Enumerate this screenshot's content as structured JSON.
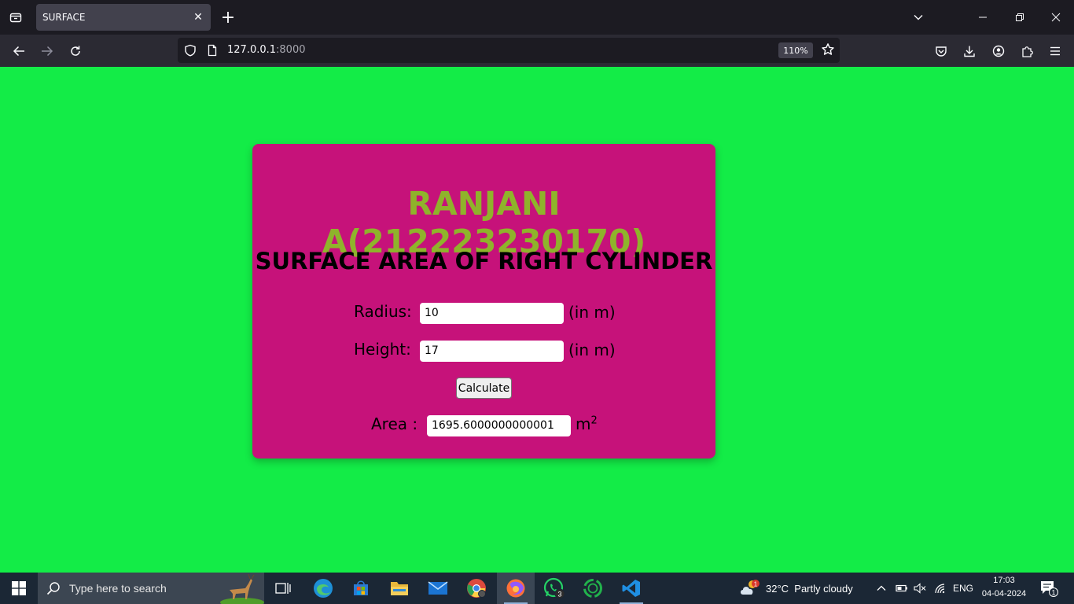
{
  "browser": {
    "tab_title": "SURFACE",
    "url_host": "127.0.0.1",
    "url_port": ":8000",
    "zoom": "110%"
  },
  "card": {
    "heading": "RANJANI A(212223230170)",
    "subheading": "SURFACE AREA OF RIGHT CYLINDER",
    "radius_label": "Radius:",
    "radius_value": "10",
    "radius_unit": "(in m)",
    "height_label": "Height:",
    "height_value": "17",
    "height_unit": "(in m)",
    "calculate_label": "Calculate",
    "area_label": "Area :",
    "area_value": "1695.6000000000001",
    "area_unit": "m",
    "area_unit_exp": "2"
  },
  "colors": {
    "page_background": "#13ec47",
    "card_background": "#c6127a",
    "heading_color": "#8fb32b"
  },
  "taskbar": {
    "search_placeholder": "Type here to search",
    "weather": "32°C  Partly cloudy",
    "weather_badge": "1",
    "language": "ENG",
    "time": "17:03",
    "date": "04-04-2024",
    "whatsapp_badge": "3",
    "notification_count": "1",
    "icons": [
      "task-view-icon",
      "edge-icon",
      "store-icon",
      "file-explorer-icon",
      "mail-icon",
      "chrome-icon",
      "firefox-icon",
      "whatsapp-icon",
      "app-icon",
      "vscode-icon"
    ]
  }
}
